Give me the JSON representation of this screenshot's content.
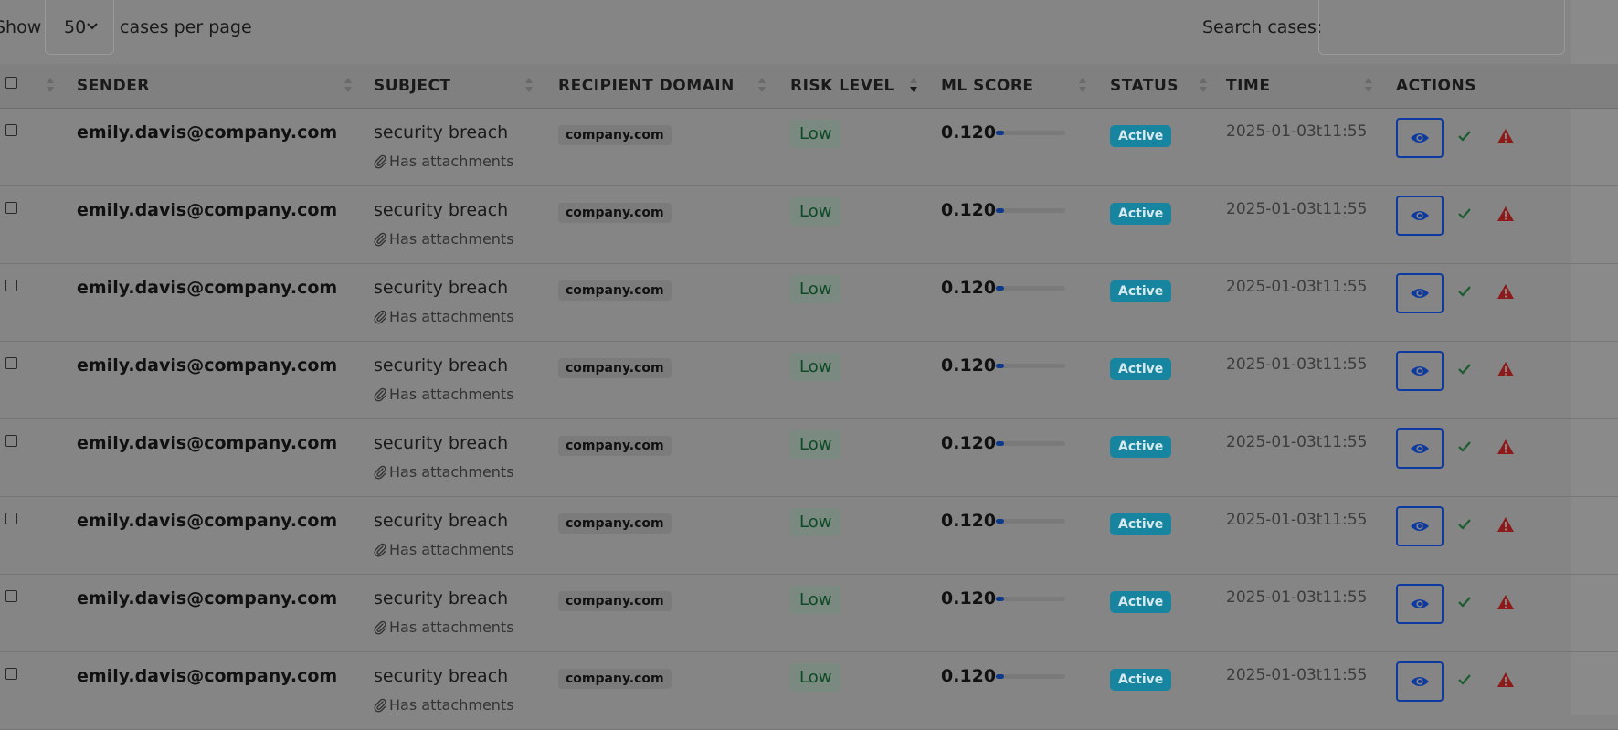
{
  "toolbar": {
    "show_label": "Show",
    "per_page_value": "50",
    "per_page_label": "cases per page",
    "search_label": "Search cases:",
    "search_value": ""
  },
  "columns": [
    {
      "key": "select",
      "label": ""
    },
    {
      "key": "sender",
      "label": "SENDER"
    },
    {
      "key": "subject",
      "label": "SUBJECT"
    },
    {
      "key": "recipient_domain",
      "label": "RECIPIENT DOMAIN"
    },
    {
      "key": "risk_level",
      "label": "RISK LEVEL",
      "sort": "descending"
    },
    {
      "key": "ml_score",
      "label": "ML SCORE"
    },
    {
      "key": "status",
      "label": "STATUS"
    },
    {
      "key": "time",
      "label": "TIME"
    },
    {
      "key": "actions",
      "label": "ACTIONS"
    }
  ],
  "rows": [
    {
      "sender": "emily.davis@company.com",
      "subject": "security breach",
      "attachments": "Has attachments",
      "domain": "company.com",
      "risk": "Low",
      "score": "0.120",
      "score_fraction": 0.12,
      "status": "Active",
      "time": "2025-01-03t11:55"
    },
    {
      "sender": "emily.davis@company.com",
      "subject": "security breach",
      "attachments": "Has attachments",
      "domain": "company.com",
      "risk": "Low",
      "score": "0.120",
      "score_fraction": 0.12,
      "status": "Active",
      "time": "2025-01-03t11:55"
    },
    {
      "sender": "emily.davis@company.com",
      "subject": "security breach",
      "attachments": "Has attachments",
      "domain": "company.com",
      "risk": "Low",
      "score": "0.120",
      "score_fraction": 0.12,
      "status": "Active",
      "time": "2025-01-03t11:55"
    },
    {
      "sender": "emily.davis@company.com",
      "subject": "security breach",
      "attachments": "Has attachments",
      "domain": "company.com",
      "risk": "Low",
      "score": "0.120",
      "score_fraction": 0.12,
      "status": "Active",
      "time": "2025-01-03t11:55"
    },
    {
      "sender": "emily.davis@company.com",
      "subject": "security breach",
      "attachments": "Has attachments",
      "domain": "company.com",
      "risk": "Low",
      "score": "0.120",
      "score_fraction": 0.12,
      "status": "Active",
      "time": "2025-01-03t11:55"
    },
    {
      "sender": "emily.davis@company.com",
      "subject": "security breach",
      "attachments": "Has attachments",
      "domain": "company.com",
      "risk": "Low",
      "score": "0.120",
      "score_fraction": 0.12,
      "status": "Active",
      "time": "2025-01-03t11:55"
    },
    {
      "sender": "emily.davis@company.com",
      "subject": "security breach",
      "attachments": "Has attachments",
      "domain": "company.com",
      "risk": "Low",
      "score": "0.120",
      "score_fraction": 0.12,
      "status": "Active",
      "time": "2025-01-03t11:55"
    },
    {
      "sender": "emily.davis@company.com",
      "subject": "security breach",
      "attachments": "Has attachments",
      "domain": "company.com",
      "risk": "Low",
      "score": "0.120",
      "score_fraction": 0.12,
      "status": "Active",
      "time": "2025-01-03t11:55"
    }
  ],
  "icons": {
    "view": "eye-icon",
    "approve": "check-icon",
    "flag": "warning-triangle-icon",
    "attachment": "paperclip-icon"
  },
  "colors": {
    "overlay_background": "#858585",
    "view_button": "#0d3aa0",
    "approve": "#1a5c2e",
    "flag": "#8c1a1a",
    "status_active": "#1785a0",
    "risk_low_text": "#0f4a26",
    "score_fill": "#0d3a8c"
  }
}
